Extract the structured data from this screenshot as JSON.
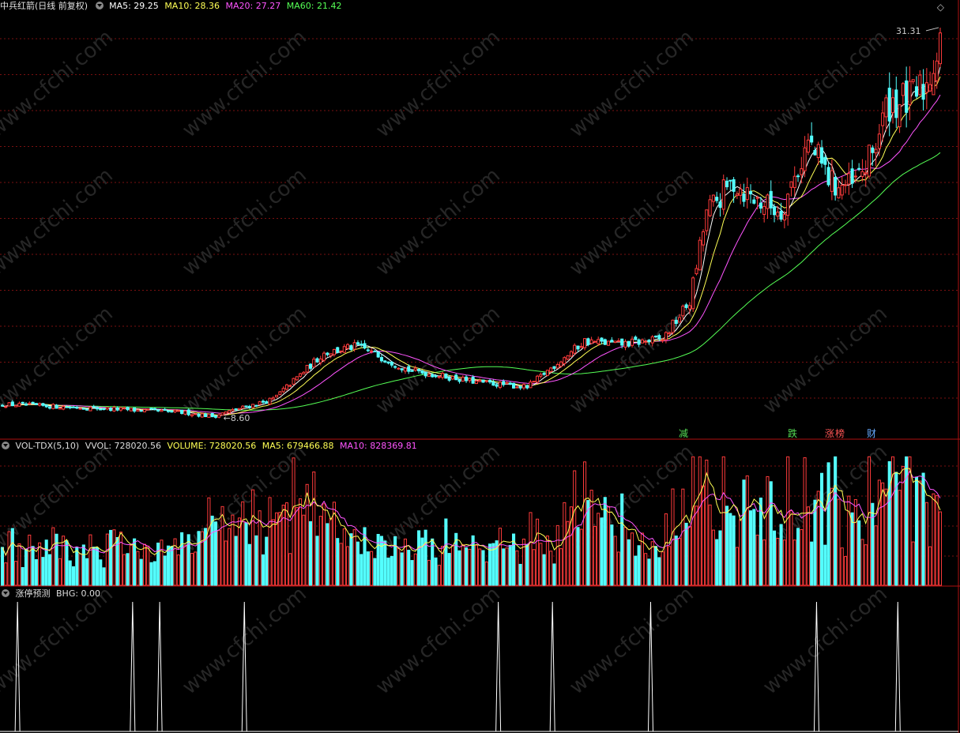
{
  "header": {
    "title": "中兵红箭(日线 前复权)",
    "ma5": "MA5: 29.25",
    "ma10": "MA10: 28.36",
    "ma20": "MA20: 27.27",
    "ma60": "MA60: 21.42"
  },
  "vol_header": {
    "title": "VOL-TDX(5,10)",
    "vvol": "VVOL: 728020.56",
    "volume": "VOLUME: 728020.56",
    "ma5": "MA5: 679466.88",
    "ma10": "MA10: 828369.81"
  },
  "ind_header": {
    "title": "涨停预测",
    "bhg": "BHG: 0.00"
  },
  "badges": [
    {
      "label": "减",
      "color": "#55dd55"
    },
    {
      "label": "跌",
      "color": "#55dd55"
    },
    {
      "label": "涨",
      "color": "#ff5555"
    },
    {
      "label": "榜",
      "color": "#ff5555"
    },
    {
      "label": "财",
      "color": "#66aaff"
    }
  ],
  "watermark": "www.cfchi.com",
  "colors": {
    "up": "#ff3b3b",
    "down": "#54ffff",
    "ma5": "#ffffff",
    "ma10": "#ffff55",
    "ma20": "#ff55ff",
    "ma60": "#55ff55",
    "grid": "#7a1010"
  },
  "chart_data": {
    "type": "candlestick",
    "price_high_label": "31.31",
    "price_low_label": "8.60",
    "price_range": [
      8.0,
      32.0
    ],
    "ohlc_keyframes": [
      [
        0,
        9.3
      ],
      [
        25,
        9.1
      ],
      [
        55,
        8.8
      ],
      [
        62,
        8.6
      ],
      [
        80,
        9.6
      ],
      [
        95,
        12.3
      ],
      [
        105,
        12.7
      ],
      [
        120,
        11.3
      ],
      [
        140,
        10.6
      ],
      [
        155,
        10.3
      ],
      [
        172,
        13.0
      ],
      [
        182,
        12.8
      ],
      [
        195,
        13.1
      ],
      [
        203,
        15.3
      ],
      [
        208,
        20.5
      ],
      [
        216,
        22.3
      ],
      [
        222,
        21.3
      ],
      [
        230,
        20.6
      ],
      [
        238,
        24.6
      ],
      [
        245,
        22.2
      ],
      [
        251,
        22.0
      ],
      [
        256,
        23.5
      ],
      [
        262,
        27.0
      ],
      [
        268,
        27.0
      ],
      [
        273,
        28.0
      ],
      [
        277,
        30.7
      ]
    ],
    "volume_range": [
      0,
      1300000
    ],
    "volume_last": 728020.56,
    "bhg_spike_days": [
      4,
      38,
      46,
      71,
      146,
      162,
      191,
      240,
      264
    ],
    "bhg_value": 0.0
  }
}
